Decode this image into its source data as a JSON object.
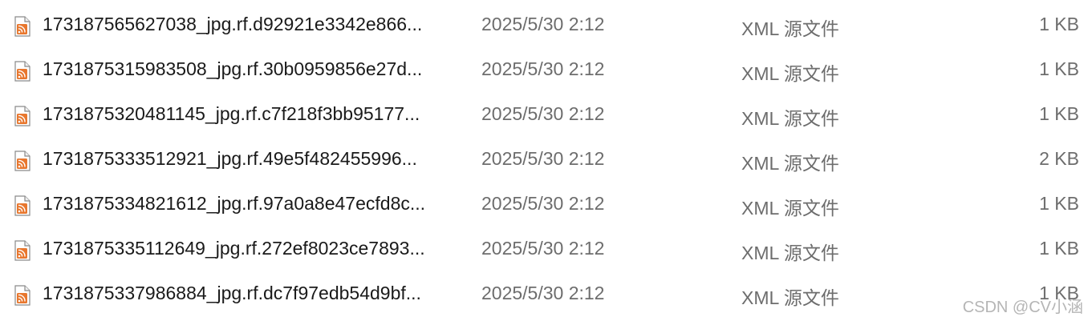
{
  "icon": "xml-rss-file-icon",
  "colors": {
    "icon_orange": "#e8772e",
    "name_text": "#1a1a1a",
    "meta_text": "#6d6d6d"
  },
  "files": [
    {
      "name": "173187565627038_jpg.rf.d92921e3342e866...",
      "date": "2025/5/30 2:12",
      "type": "XML 源文件",
      "size": "1 KB"
    },
    {
      "name": "1731875315983508_jpg.rf.30b0959856e27d...",
      "date": "2025/5/30 2:12",
      "type": "XML 源文件",
      "size": "1 KB"
    },
    {
      "name": "1731875320481145_jpg.rf.c7f218f3bb95177...",
      "date": "2025/5/30 2:12",
      "type": "XML 源文件",
      "size": "1 KB"
    },
    {
      "name": "1731875333512921_jpg.rf.49e5f482455996...",
      "date": "2025/5/30 2:12",
      "type": "XML 源文件",
      "size": "2 KB"
    },
    {
      "name": "1731875334821612_jpg.rf.97a0a8e47ecfd8c...",
      "date": "2025/5/30 2:12",
      "type": "XML 源文件",
      "size": "1 KB"
    },
    {
      "name": "1731875335112649_jpg.rf.272ef8023ce7893...",
      "date": "2025/5/30 2:12",
      "type": "XML 源文件",
      "size": "1 KB"
    },
    {
      "name": "1731875337986884_jpg.rf.dc7f97edb54d9bf...",
      "date": "2025/5/30 2:12",
      "type": "XML 源文件",
      "size": "1 KB"
    }
  ],
  "watermark": "CSDN @CV小涵"
}
